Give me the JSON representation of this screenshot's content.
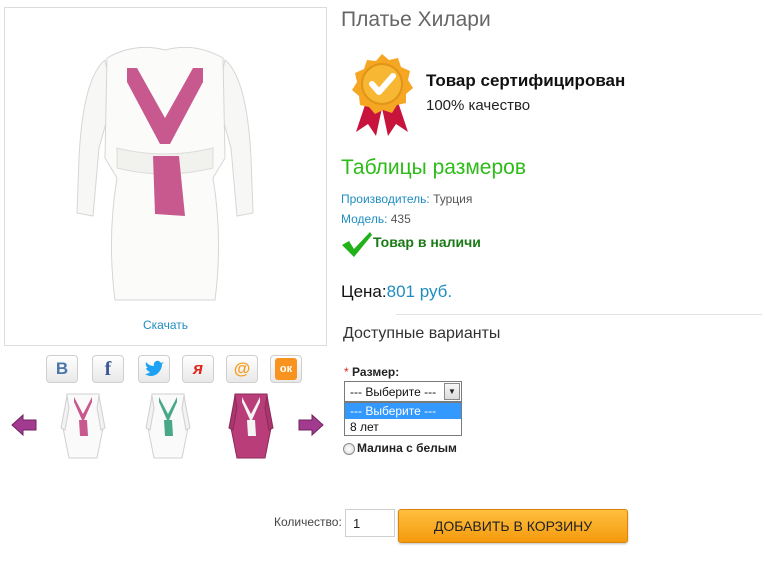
{
  "product": {
    "title": "Платье Хилари",
    "download_label": "Скачать"
  },
  "certificate": {
    "title": "Товар сертифицирован",
    "subtitle": "100% качество"
  },
  "size_table_link": "Таблицы размеров",
  "meta": {
    "manufacturer_label": "Производитель:",
    "manufacturer_value": "Турция",
    "model_label": "Модель:",
    "model_value": "435"
  },
  "stock": {
    "text": "Товар в наличи"
  },
  "price": {
    "label": "Цена:",
    "value": "801 руб."
  },
  "variants": {
    "title": "Доступные варианты",
    "size_label": "Размер:",
    "size_required_marker": "*",
    "select_value": "--- Выберите ---",
    "options": [
      "--- Выберите ---",
      "8 лет"
    ],
    "color_option": "Малина с белым"
  },
  "share": {
    "buttons": [
      {
        "icon": "vk-icon",
        "glyph": "В",
        "color": "#4a76a8"
      },
      {
        "icon": "facebook-icon",
        "glyph": "f",
        "color": "#3b5998"
      },
      {
        "icon": "twitter-icon",
        "glyph": "",
        "color": "#1da1f2"
      },
      {
        "icon": "yandex-icon",
        "glyph": "я",
        "color": "#e0261f"
      },
      {
        "icon": "mailru-icon",
        "glyph": "@",
        "color": "#f79e1b"
      },
      {
        "icon": "odnoklassniki-icon",
        "glyph": "ок",
        "color": "#f7931e"
      }
    ]
  },
  "thumbnails": [
    {
      "body_color": "#fafafa",
      "accent_color": "#c8598f"
    },
    {
      "body_color": "#fafafa",
      "accent_color": "#4aa88a"
    },
    {
      "body_color": "#b83d78",
      "accent_color": "#f4f4f4"
    }
  ],
  "quantity": {
    "label": "Количество:",
    "value": "1"
  },
  "cart_button": {
    "label": "ДОБАВИТЬ В КОРЗИНУ"
  },
  "colors": {
    "link_blue": "#1f8dc1",
    "green": "#2dbb18",
    "accent_pink": "#c8598f",
    "button_orange": "#f49a0e"
  }
}
